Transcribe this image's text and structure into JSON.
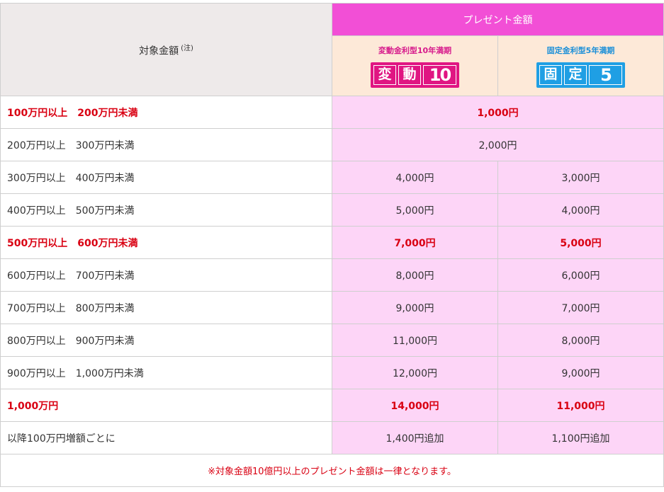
{
  "header": {
    "target_label": "対象金額",
    "target_note": "(注)",
    "present_label": "プレゼント金額",
    "plans": [
      {
        "title": "変動金利型10年満期",
        "badge_chars": [
          "変",
          "動"
        ],
        "badge_num": "10",
        "color": "#e01582"
      },
      {
        "title": "固定金利型5年満期",
        "badge_chars": [
          "固",
          "定"
        ],
        "badge_num": "5",
        "color": "#1f9fe4"
      }
    ]
  },
  "rows": [
    {
      "label": "100万円以上　200万円未満",
      "merged": "1,000円"
    },
    {
      "label": "200万円以上　300万円未満",
      "merged": "2,000円"
    },
    {
      "label": "300万円以上　400万円未満",
      "hendo": "4,000円",
      "kotei": "3,000円"
    },
    {
      "label": "400万円以上　500万円未満",
      "hendo": "5,000円",
      "kotei": "4,000円"
    },
    {
      "label": "500万円以上　600万円未満",
      "hendo": "7,000円",
      "kotei": "5,000円"
    },
    {
      "label": "600万円以上　700万円未満",
      "hendo": "8,000円",
      "kotei": "6,000円"
    },
    {
      "label": "700万円以上　800万円未満",
      "hendo": "9,000円",
      "kotei": "7,000円"
    },
    {
      "label": "800万円以上　900万円未満",
      "hendo": "11,000円",
      "kotei": "8,000円"
    },
    {
      "label": "900万円以上　1,000万円未満",
      "hendo": "12,000円",
      "kotei": "9,000円"
    },
    {
      "label": "1,000万円",
      "hendo": "14,000円",
      "kotei": "11,000円"
    },
    {
      "label": "以降100万円増額ごとに",
      "hendo": "1,400円追加",
      "kotei": "1,100円追加"
    }
  ],
  "footnote": "※対象金額10億円以上のプレゼント金額は一律となります。",
  "colors": {
    "highlight_text": "#d90012",
    "present_header_bg": "#f24fd6",
    "value_cell_bg": "#fdd5f7",
    "plan_header_bg": "#fde9d8"
  }
}
